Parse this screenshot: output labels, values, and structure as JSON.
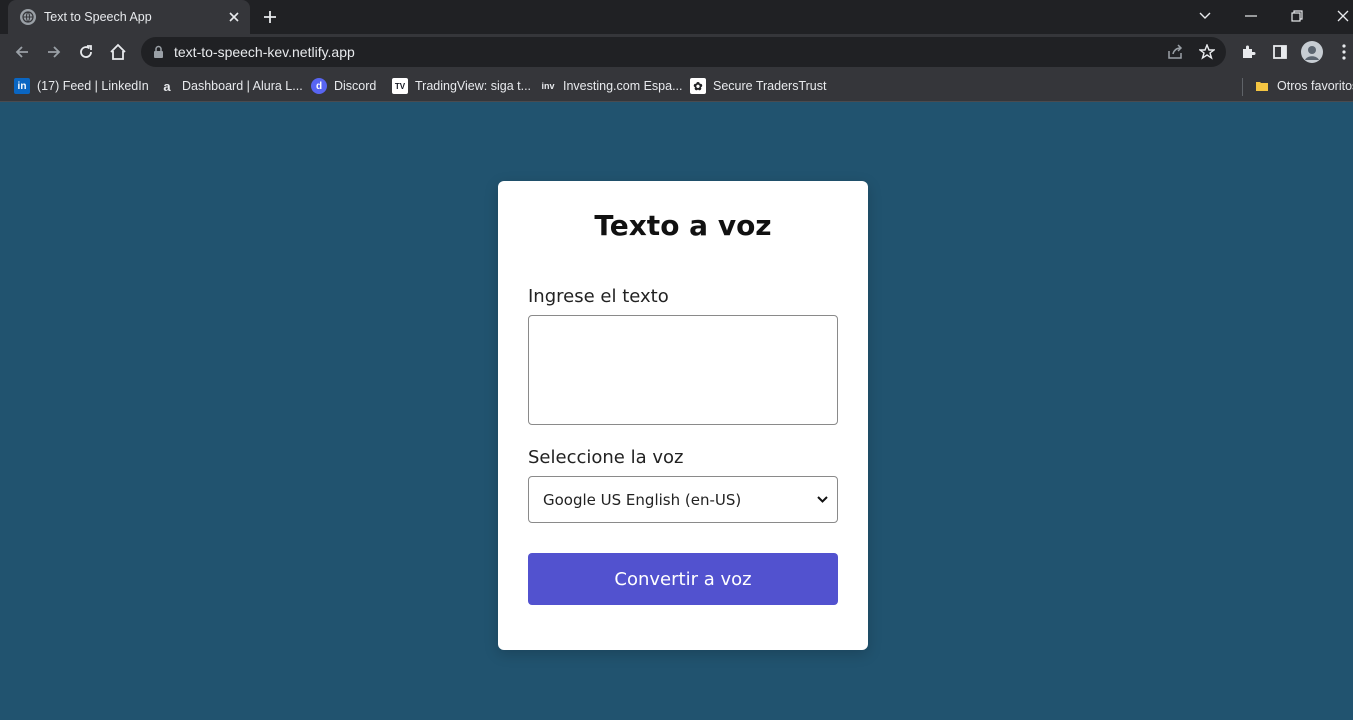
{
  "browser": {
    "tab_title": "Text to Speech App",
    "url": "text-to-speech-kev.netlify.app",
    "bookmarks": [
      {
        "label": "(17) Feed | LinkedIn",
        "icon": "linkedin-icon",
        "icon_text": "in",
        "color": "#0a66c2"
      },
      {
        "label": "Dashboard | Alura L...",
        "icon": "alura-icon",
        "icon_text": "a",
        "color": "#35363a"
      },
      {
        "label": "Discord",
        "icon": "discord-icon",
        "icon_text": "d",
        "color": "#5865f2"
      },
      {
        "label": "TradingView: siga t...",
        "icon": "tradingview-icon",
        "icon_text": "TV",
        "color": "#ffffff"
      },
      {
        "label": "Investing.com Espa...",
        "icon": "investing-icon",
        "icon_text": "inv",
        "color": "#35363a"
      },
      {
        "label": "Secure TradersTrust",
        "icon": "traderstrust-icon",
        "icon_text": "✿",
        "color": "#ffffff"
      }
    ],
    "other_bookmarks": "Otros favoritos"
  },
  "app": {
    "title": "Texto a voz",
    "text_label": "Ingrese el texto",
    "text_value": "",
    "voice_label": "Seleccione la voz",
    "voice_selected": "Google US English (en-US)",
    "convert_label": "Convertir a voz",
    "colors": {
      "background": "#21536f",
      "button": "#5252cf"
    }
  }
}
